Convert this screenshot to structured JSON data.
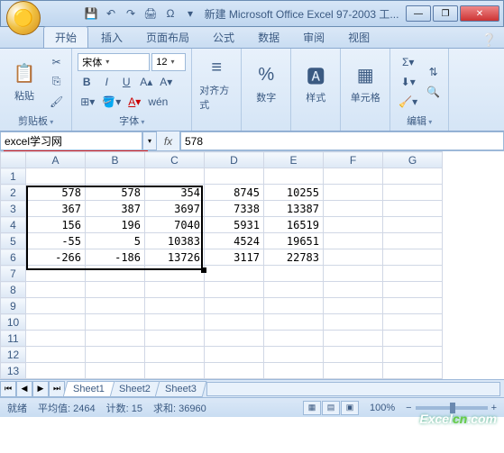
{
  "title": "新建 Microsoft Office Excel 97-2003 工...",
  "tabs": {
    "home": "开始",
    "insert": "插入",
    "layout": "页面布局",
    "formulas": "公式",
    "data": "数据",
    "review": "审阅",
    "view": "视图"
  },
  "ribbon": {
    "clipboard": {
      "paste": "粘贴",
      "label": "剪贴板"
    },
    "font": {
      "name": "宋体",
      "size": "12",
      "label": "字体",
      "wen": "wén"
    },
    "align": {
      "label": "对齐方式"
    },
    "number": {
      "label": "数字"
    },
    "styles": {
      "label": "样式"
    },
    "cells": {
      "label": "单元格"
    },
    "editing": {
      "label": "编辑"
    }
  },
  "namebox": "excel学习网",
  "formula": "578",
  "cols": [
    "A",
    "B",
    "C",
    "D",
    "E",
    "F",
    "G"
  ],
  "chart_data": {
    "type": "table",
    "columns": [
      "A",
      "B",
      "C",
      "D",
      "E"
    ],
    "rows": [
      {
        "r": 2,
        "A": 578,
        "B": 578,
        "C": 354,
        "D": 8745,
        "E": 10255
      },
      {
        "r": 3,
        "A": 367,
        "B": 387,
        "C": 3697,
        "D": 7338,
        "E": 13387
      },
      {
        "r": 4,
        "A": 156,
        "B": 196,
        "C": 7040,
        "D": 5931,
        "E": 16519
      },
      {
        "r": 5,
        "A": -55,
        "B": 5,
        "C": 10383,
        "D": 4524,
        "E": 19651
      },
      {
        "r": 6,
        "A": -266,
        "B": -186,
        "C": 13726,
        "D": 3117,
        "E": 22783
      }
    ]
  },
  "sheets": [
    "Sheet1",
    "Sheet2",
    "Sheet3"
  ],
  "status": {
    "ready": "就绪",
    "avg_label": "平均值:",
    "avg": "2464",
    "count_label": "计数:",
    "count": "15",
    "sum_label": "求和:",
    "sum": "36960",
    "zoom": "100%"
  },
  "watermark": "Excelcn.com"
}
